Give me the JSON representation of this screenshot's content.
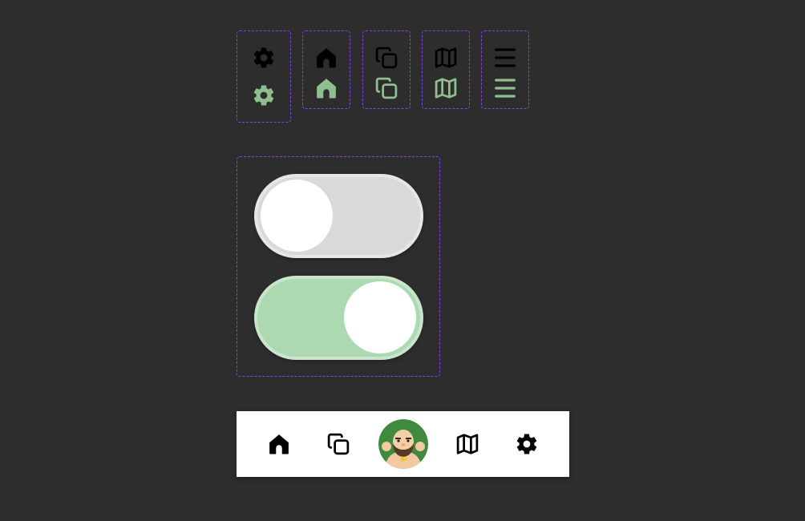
{
  "colors": {
    "background": "#2d2d2d",
    "border_dashed": "#8a3ff0",
    "icon_dark": "#000000",
    "icon_green": "#8fbf8f",
    "toggle_off": "#d9d9d9",
    "toggle_on": "#acd9b2",
    "nav_bg": "#ffffff"
  },
  "icon_previews": [
    {
      "name": "gear-icon",
      "variants": [
        "dark",
        "green"
      ]
    },
    {
      "name": "home-icon",
      "variants": [
        "dark",
        "green"
      ]
    },
    {
      "name": "copy-icon",
      "variants": [
        "dark",
        "green"
      ]
    },
    {
      "name": "map-icon",
      "variants": [
        "dark",
        "green"
      ]
    },
    {
      "name": "menu-icon",
      "variants": [
        "dark",
        "green"
      ]
    }
  ],
  "toggles": [
    {
      "state": "off"
    },
    {
      "state": "on"
    }
  ],
  "nav_bar": {
    "items": [
      "home-icon",
      "copy-icon",
      "avatar",
      "map-icon",
      "gear-icon"
    ]
  }
}
